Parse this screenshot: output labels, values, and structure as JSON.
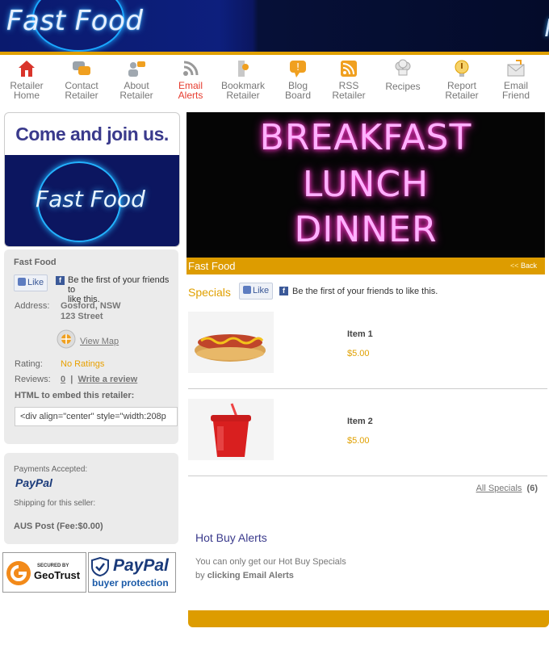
{
  "header": {
    "logo_text": "Fast Food",
    "logo_text_partial": "Fa"
  },
  "nav": [
    {
      "line1": "Retailer",
      "line2": "Home",
      "icon": "home-icon"
    },
    {
      "line1": "Contact",
      "line2": "Retailer",
      "icon": "chat-bubbles-icon"
    },
    {
      "line1": "About",
      "line2": "Retailer",
      "icon": "people-icon"
    },
    {
      "line1": "Email",
      "line2": "Alerts",
      "icon": "rss-icon"
    },
    {
      "line1": "Bookmark",
      "line2": "Retailer",
      "icon": "bookmark-icon"
    },
    {
      "line1": "Blog",
      "line2": "Board",
      "icon": "speech-bubble-icon"
    },
    {
      "line1": "RSS",
      "line2": "Retailer",
      "icon": "rss-feed-icon"
    },
    {
      "line1": "Recipes",
      "line2": "",
      "icon": "chef-hat-icon"
    },
    {
      "line1": "Report",
      "line2": "Retailer",
      "icon": "alert-icon"
    },
    {
      "line1": "Email",
      "line2": "Friend",
      "icon": "envelope-icon"
    }
  ],
  "sidebar": {
    "join_title": "Come and join us.",
    "join_logo": "Fast Food",
    "retailer_name": "Fast Food",
    "like_label": "Like",
    "like_text_1": "Be the first of your friends to",
    "like_text_2": "like this.",
    "address_label": "Address:",
    "address_line1": "Gosford, NSW",
    "address_line2": "123 Street",
    "view_map": "View Map",
    "rating_label": "Rating:",
    "rating_value": "No Ratings",
    "reviews_label": "Reviews:",
    "reviews_count": "0",
    "reviews_sep": "|",
    "write_review": "Write a review",
    "embed_label": "HTML to embed this retailer:",
    "embed_value": "<div align=\"center\" style=\"width:208p",
    "payments_label": "Payments Accepted:",
    "payments_method": "PayPal",
    "shipping_label": "Shipping for this seller:",
    "shipping_value": "AUS Post (Fee:$0.00)",
    "geotrust_small": "SECURED BY",
    "geotrust_name": "GeoTrust",
    "paypal_badge_name": "PayPal",
    "paypal_badge_sub": "buyer protection"
  },
  "main": {
    "hero_lines": [
      "BREAKFAST",
      "LUNCH",
      "DINNER"
    ],
    "hero_title": "Fast Food",
    "back_label": "Back",
    "back_arrows": "<<",
    "specials_title": "Specials",
    "like_label": "Like",
    "like_text": "Be the first of your friends to like this.",
    "items": [
      {
        "name": "Item 1",
        "price": "$5.00",
        "image": "hotdog-image"
      },
      {
        "name": "Item 2",
        "price": "$5.00",
        "image": "soda-cup-image"
      }
    ],
    "all_specials": "All Specials",
    "all_specials_count": "(6)",
    "hot_title": "Hot Buy Alerts",
    "hot_text_1": "You can only get our Hot Buy Specials",
    "hot_text_2_prefix": "by",
    "hot_text_2_bold": "clicking Email Alerts"
  },
  "colors": {
    "accent": "#dd9c00",
    "active_nav": "#e63b2e",
    "brand_navy": "#3a3a8c"
  }
}
